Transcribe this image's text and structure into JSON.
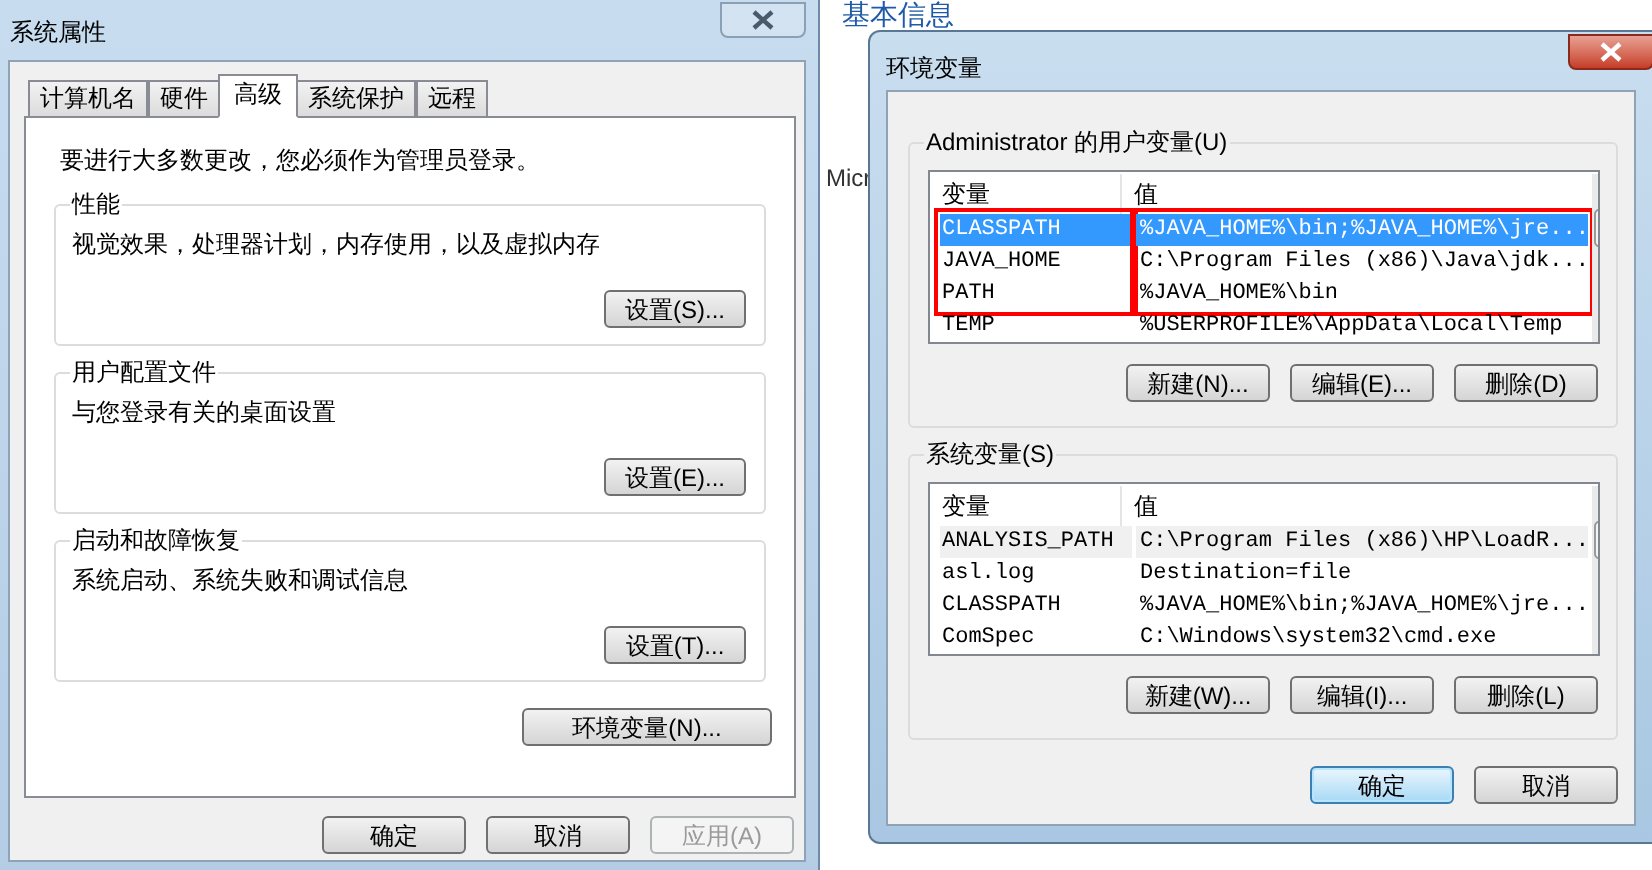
{
  "background_page": {
    "heading": "基本信息",
    "text": "Micr"
  },
  "system_properties": {
    "title": "系统属性",
    "tabs": [
      {
        "label": "计算机名",
        "selected": false
      },
      {
        "label": "硬件",
        "selected": false
      },
      {
        "label": "高级",
        "selected": true
      },
      {
        "label": "系统保护",
        "selected": false
      },
      {
        "label": "远程",
        "selected": false
      }
    ],
    "notice": "要进行大多数更改，您必须作为管理员登录。",
    "groups": [
      {
        "title": "性能",
        "description": "视觉效果，处理器计划，内存使用，以及虚拟内存",
        "button": "设置(S)..."
      },
      {
        "title": "用户配置文件",
        "description": "与您登录有关的桌面设置",
        "button": "设置(E)..."
      },
      {
        "title": "启动和故障恢复",
        "description": "系统启动、系统失败和调试信息",
        "button": "设置(T)..."
      }
    ],
    "env_button": "环境变量(N)...",
    "buttons": [
      {
        "label": "确定",
        "disabled": false
      },
      {
        "label": "取消",
        "disabled": false
      },
      {
        "label": "应用(A)",
        "disabled": true
      }
    ]
  },
  "environment_variables": {
    "title": "环境变量",
    "lists": [
      {
        "title": "Administrator 的用户变量(U)",
        "active": true,
        "columns": [
          "变量",
          "值"
        ],
        "rows": [
          {
            "name": "CLASSPATH",
            "value": "%JAVA_HOME%\\bin;%JAVA_HOME%\\jre...",
            "selected": true,
            "highlighted": true
          },
          {
            "name": "JAVA_HOME",
            "value": "C:\\Program Files (x86)\\Java\\jdk...",
            "selected": false,
            "highlighted": true
          },
          {
            "name": "PATH",
            "value": "%JAVA_HOME%\\bin",
            "selected": false,
            "highlighted": true
          },
          {
            "name": "TEMP",
            "value": "%USERPROFILE%\\AppData\\Local\\Temp",
            "selected": false,
            "highlighted": false
          }
        ],
        "buttons": [
          "新建(N)...",
          "编辑(E)...",
          "删除(D)"
        ]
      },
      {
        "title": "系统变量(S)",
        "active": false,
        "columns": [
          "变量",
          "值"
        ],
        "rows": [
          {
            "name": "ANALYSIS_PATH",
            "value": "C:\\Program Files (x86)\\HP\\LoadR...",
            "selected": true,
            "highlighted": false
          },
          {
            "name": "asl.log",
            "value": "Destination=file",
            "selected": false,
            "highlighted": false
          },
          {
            "name": "CLASSPATH",
            "value": "%JAVA_HOME%\\bin;%JAVA_HOME%\\jre...",
            "selected": false,
            "highlighted": false
          },
          {
            "name": "ComSpec",
            "value": "C:\\Windows\\system32\\cmd.exe",
            "selected": false,
            "highlighted": false
          }
        ],
        "buttons": [
          "新建(W)...",
          "编辑(I)...",
          "删除(L)"
        ]
      }
    ],
    "buttons": [
      {
        "label": "确定",
        "default": true
      },
      {
        "label": "取消",
        "default": false
      }
    ]
  }
}
